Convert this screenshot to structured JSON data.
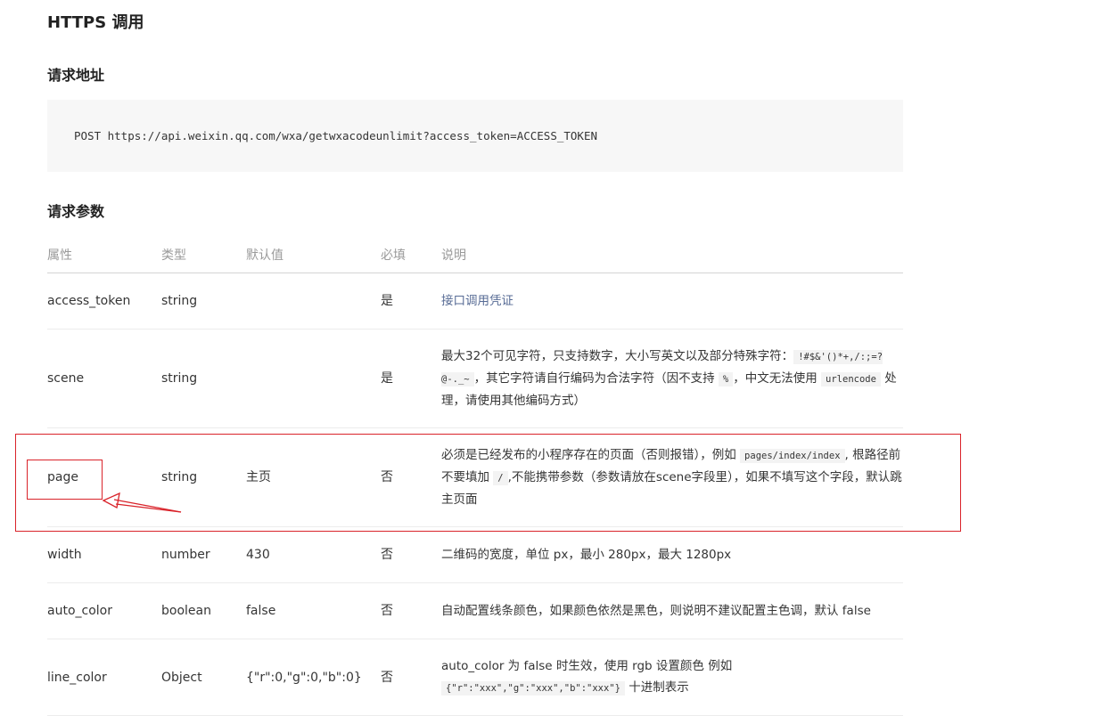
{
  "section_title": "HTTPS 调用",
  "request_url": {
    "heading": "请求地址",
    "code": "POST https://api.weixin.qq.com/wxa/getwxacodeunlimit?access_token=ACCESS_TOKEN"
  },
  "params": {
    "heading": "请求参数",
    "columns": [
      "属性",
      "类型",
      "默认值",
      "必填",
      "说明"
    ],
    "rows": [
      {
        "name": "access_token",
        "type": "string",
        "default": "",
        "required": "是",
        "desc": "接口调用凭证"
      },
      {
        "name": "scene",
        "type": "string",
        "default": "",
        "required": "是",
        "desc_p1": "最大32个可见字符，只支持数字，大小写英文以及部分特殊字符：",
        "desc_code1": "!#$&'()*+,/:;=?@-._~",
        "desc_p2": "，其它字符请自行编码为合法字符（因不支持",
        "desc_code2": "%",
        "desc_p3": "，中文无法使用",
        "desc_code3": "urlencode",
        "desc_p4": "处理，请使用其他编码方式）"
      },
      {
        "name": "page",
        "type": "string",
        "default": "主页",
        "required": "否",
        "desc_p1": "必须是已经发布的小程序存在的页面（否则报错），例如",
        "desc_code1": "pages/index/index",
        "desc_p2": ", 根路径前不要填加",
        "desc_code2": "/",
        "desc_p3": ",不能携带参数（参数请放在scene字段里），如果不填写这个字段，默认跳主页面"
      },
      {
        "name": "width",
        "type": "number",
        "default": "430",
        "required": "否",
        "desc": "二维码的宽度，单位 px，最小 280px，最大 1280px"
      },
      {
        "name": "auto_color",
        "type": "boolean",
        "default": "false",
        "required": "否",
        "desc": "自动配置线条颜色，如果颜色依然是黑色，则说明不建议配置主色调，默认 false"
      },
      {
        "name": "line_color",
        "type": "Object",
        "default": "{\"r\":0,\"g\":0,\"b\":0}",
        "required": "否",
        "desc_p1": "auto_color 为 false 时生效，使用 rgb 设置颜色 例如",
        "desc_code1": "{\"r\":\"xxx\",\"g\":\"xxx\",\"b\":\"xxx\"}",
        "desc_p2": "十进制表示"
      }
    ]
  },
  "colors": {
    "annotation": "#d9232a",
    "link": "#576b95",
    "code_bg": "#f7f7f7"
  }
}
